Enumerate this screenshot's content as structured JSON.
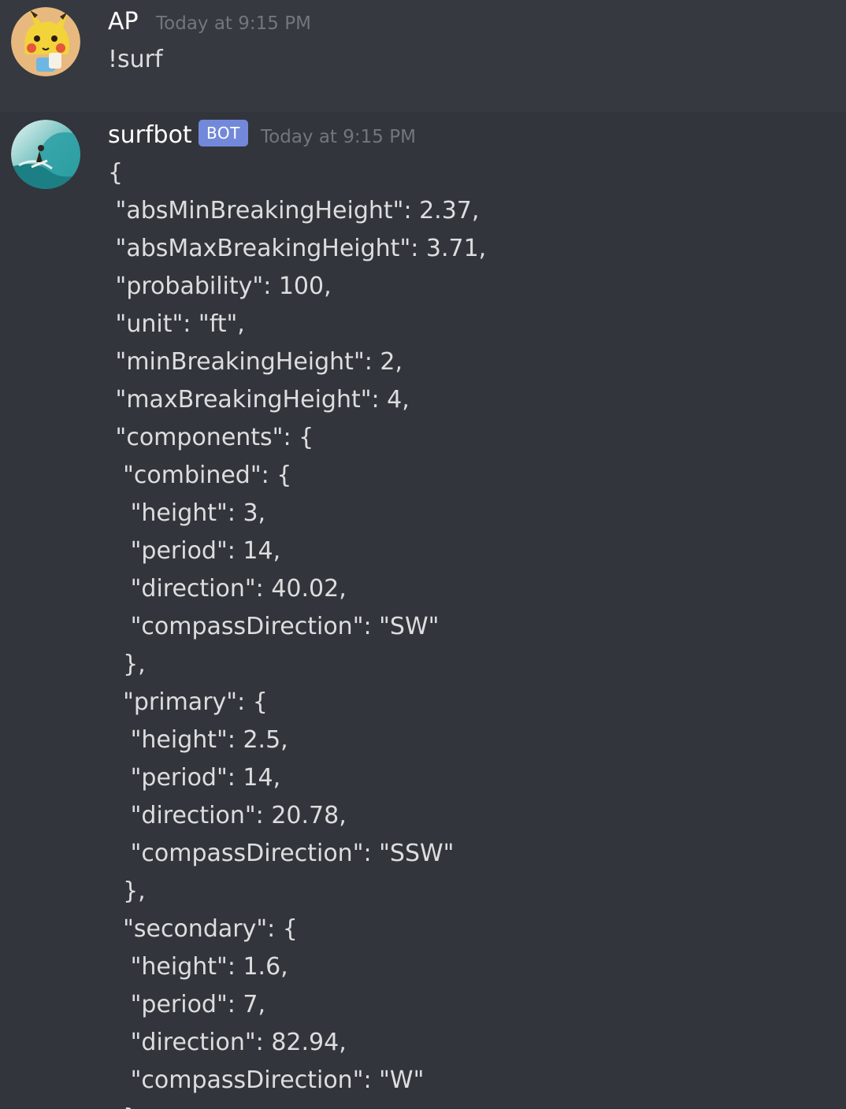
{
  "messages": [
    {
      "author": "AP",
      "avatar": "pikachu-avatar",
      "timestamp": "Today at 9:15 PM",
      "content": "!surf"
    },
    {
      "author": "surfbot",
      "badge": "BOT",
      "avatar": "surfer-avatar",
      "timestamp": "Today at 9:15 PM",
      "content": "{\n \"absMinBreakingHeight\": 2.37,\n \"absMaxBreakingHeight\": 3.71,\n \"probability\": 100,\n \"unit\": \"ft\",\n \"minBreakingHeight\": 2,\n \"maxBreakingHeight\": 4,\n \"components\": {\n  \"combined\": {\n   \"height\": 3,\n   \"period\": 14,\n   \"direction\": 40.02,\n   \"compassDirection\": \"SW\"\n  },\n  \"primary\": {\n   \"height\": 2.5,\n   \"period\": 14,\n   \"direction\": 20.78,\n   \"compassDirection\": \"SSW\"\n  },\n  \"secondary\": {\n   \"height\": 1.6,\n   \"period\": 7,\n   \"direction\": 82.94,\n   \"compassDirection\": \"W\"\n  }"
    }
  ],
  "colors": {
    "background": "#36393f",
    "username": "#ffffff",
    "timestamp": "#72767d",
    "message_text": "#dcddde",
    "bot_badge": "#7289da"
  }
}
